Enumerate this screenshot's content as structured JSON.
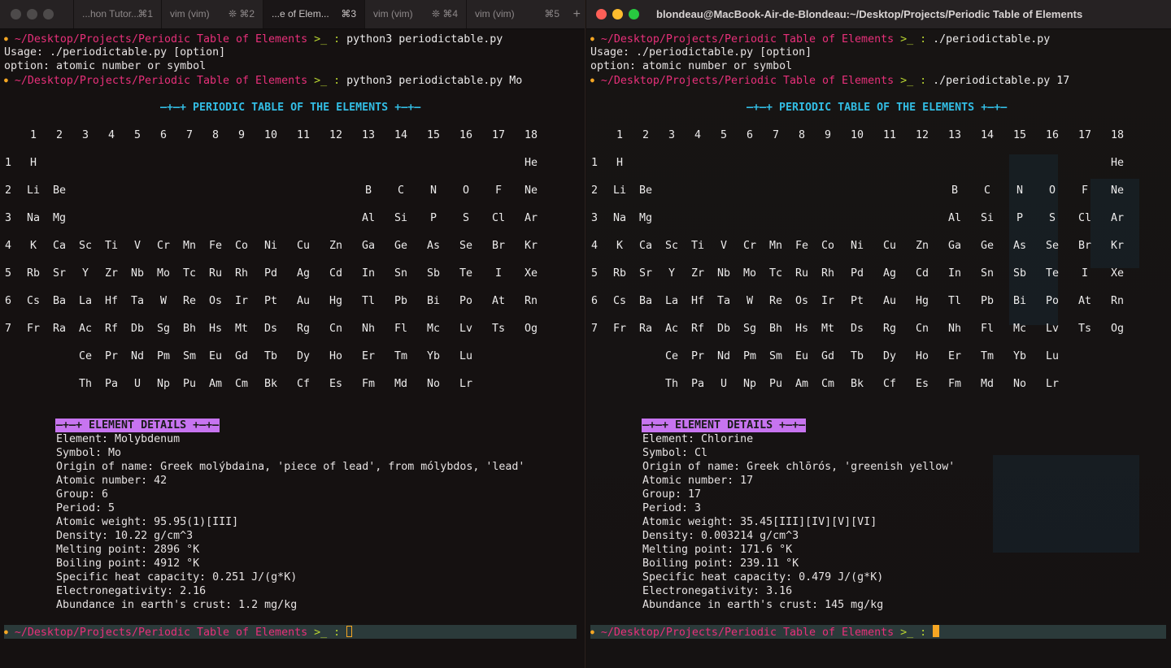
{
  "tabs": [
    {
      "title": "...hon Tutor...",
      "shortcut": "⌘1"
    },
    {
      "title": "vim (vim)",
      "shortcut": "⌘2",
      "spinner": true
    },
    {
      "title": "...e of Elem...",
      "shortcut": "⌘3",
      "active": true
    },
    {
      "title": "vim (vim)",
      "shortcut": "⌘4",
      "spinner": true
    },
    {
      "title": "vim (vim)",
      "shortcut": "⌘5"
    }
  ],
  "new_tab": "+",
  "right_window_title": "blondeau@MacBook-Air-de-Blondeau:~/Desktop/Projects/Periodic Table of Elements",
  "prompt": {
    "path": "~/Desktop/Projects/Periodic Table of Elements",
    "symbol": ">_ :"
  },
  "left": {
    "cmd1": "python3 periodictable.py",
    "usage": "Usage: ./periodictable.py [option]",
    "option": "option: atomic number or symbol",
    "cmd2": "python3 periodictable.py Mo"
  },
  "right": {
    "cmd1": "./periodictable.py",
    "usage": "Usage: ./periodictable.py [option]",
    "option": "option: atomic number or symbol",
    "cmd2": "./periodictable.py 17"
  },
  "table": {
    "banner": "—+—+ PERIODIC TABLE OF THE ELEMENTS +—+—",
    "groups": [
      "1",
      "2",
      "3",
      "4",
      "5",
      "6",
      "7",
      "8",
      "9",
      "10",
      "11",
      "12",
      "13",
      "14",
      "15",
      "16",
      "17",
      "18"
    ],
    "periods": [
      {
        "n": "1",
        "cells": [
          [
            "H",
            1
          ],
          [
            "He",
            18
          ]
        ]
      },
      {
        "n": "2",
        "cells": [
          [
            "Li",
            1
          ],
          [
            "Be",
            2
          ],
          [
            "B",
            13
          ],
          [
            "C",
            14
          ],
          [
            "N",
            15
          ],
          [
            "O",
            16
          ],
          [
            "F",
            17
          ],
          [
            "Ne",
            18
          ]
        ]
      },
      {
        "n": "3",
        "cells": [
          [
            "Na",
            1
          ],
          [
            "Mg",
            2
          ],
          [
            "Al",
            13
          ],
          [
            "Si",
            14
          ],
          [
            "P",
            15
          ],
          [
            "S",
            16
          ],
          [
            "Cl",
            17
          ],
          [
            "Ar",
            18
          ]
        ]
      },
      {
        "n": "4",
        "cells": [
          [
            "K",
            1
          ],
          [
            "Ca",
            2
          ],
          [
            "Sc",
            3
          ],
          [
            "Ti",
            4
          ],
          [
            "V",
            5
          ],
          [
            "Cr",
            6
          ],
          [
            "Mn",
            7
          ],
          [
            "Fe",
            8
          ],
          [
            "Co",
            9
          ],
          [
            "Ni",
            10
          ],
          [
            "Cu",
            11
          ],
          [
            "Zn",
            12
          ],
          [
            "Ga",
            13
          ],
          [
            "Ge",
            14
          ],
          [
            "As",
            15
          ],
          [
            "Se",
            16
          ],
          [
            "Br",
            17
          ],
          [
            "Kr",
            18
          ]
        ]
      },
      {
        "n": "5",
        "cells": [
          [
            "Rb",
            1
          ],
          [
            "Sr",
            2
          ],
          [
            "Y",
            3
          ],
          [
            "Zr",
            4
          ],
          [
            "Nb",
            5
          ],
          [
            "Mo",
            6
          ],
          [
            "Tc",
            7
          ],
          [
            "Ru",
            8
          ],
          [
            "Rh",
            9
          ],
          [
            "Pd",
            10
          ],
          [
            "Ag",
            11
          ],
          [
            "Cd",
            12
          ],
          [
            "In",
            13
          ],
          [
            "Sn",
            14
          ],
          [
            "Sb",
            15
          ],
          [
            "Te",
            16
          ],
          [
            "I",
            17
          ],
          [
            "Xe",
            18
          ]
        ]
      },
      {
        "n": "6",
        "cells": [
          [
            "Cs",
            1
          ],
          [
            "Ba",
            2
          ],
          [
            "La",
            3
          ],
          [
            "Hf",
            4
          ],
          [
            "Ta",
            5
          ],
          [
            "W",
            6
          ],
          [
            "Re",
            7
          ],
          [
            "Os",
            8
          ],
          [
            "Ir",
            9
          ],
          [
            "Pt",
            10
          ],
          [
            "Au",
            11
          ],
          [
            "Hg",
            12
          ],
          [
            "Tl",
            13
          ],
          [
            "Pb",
            14
          ],
          [
            "Bi",
            15
          ],
          [
            "Po",
            16
          ],
          [
            "At",
            17
          ],
          [
            "Rn",
            18
          ]
        ]
      },
      {
        "n": "7",
        "cells": [
          [
            "Fr",
            1
          ],
          [
            "Ra",
            2
          ],
          [
            "Ac",
            3
          ],
          [
            "Rf",
            4
          ],
          [
            "Db",
            5
          ],
          [
            "Sg",
            6
          ],
          [
            "Bh",
            7
          ],
          [
            "Hs",
            8
          ],
          [
            "Mt",
            9
          ],
          [
            "Ds",
            10
          ],
          [
            "Rg",
            11
          ],
          [
            "Cn",
            12
          ],
          [
            "Nh",
            13
          ],
          [
            "Fl",
            14
          ],
          [
            "Mc",
            15
          ],
          [
            "Lv",
            16
          ],
          [
            "Ts",
            17
          ],
          [
            "Og",
            18
          ]
        ]
      }
    ],
    "lanthanides": [
      "Ce",
      "Pr",
      "Nd",
      "Pm",
      "Sm",
      "Eu",
      "Gd",
      "Tb",
      "Dy",
      "Ho",
      "Er",
      "Tm",
      "Yb",
      "Lu"
    ],
    "actinides": [
      "Th",
      "Pa",
      "U",
      "Np",
      "Pu",
      "Am",
      "Cm",
      "Bk",
      "Cf",
      "Es",
      "Fm",
      "Md",
      "No",
      "Lr"
    ]
  },
  "details_header": "—+—+ ELEMENT DETAILS +—+—",
  "left_details": [
    "Element: Molybdenum",
    "Symbol: Mo",
    "Origin of name: Greek molýbdaina, 'piece of lead', from mólybdos, 'lead'",
    "Atomic number: 42",
    "Group: 6",
    "Period: 5",
    "Atomic weight: 95.95(1)[III]",
    "Density: 10.22 g/cm^3",
    "Melting point: 2896 °K",
    "Boiling point: 4912 °K",
    "Specific heat capacity: 0.251 J/(g*K)",
    "Electronegativity: 2.16",
    "Abundance in earth's crust: 1.2 mg/kg"
  ],
  "right_details": [
    "Element: Chlorine",
    "Symbol: Cl",
    "Origin of name: Greek chlōrós, 'greenish yellow'",
    "Atomic number: 17",
    "Group: 17",
    "Period: 3",
    "Atomic weight: 35.45[III][IV][V][VI]",
    "Density: 0.003214 g/cm^3",
    "Melting point: 171.6 °K",
    "Boiling point: 239.11 °K",
    "Specific heat capacity: 0.479 J/(g*K)",
    "Electronegativity: 3.16",
    "Abundance in earth's crust: 145 mg/kg"
  ]
}
